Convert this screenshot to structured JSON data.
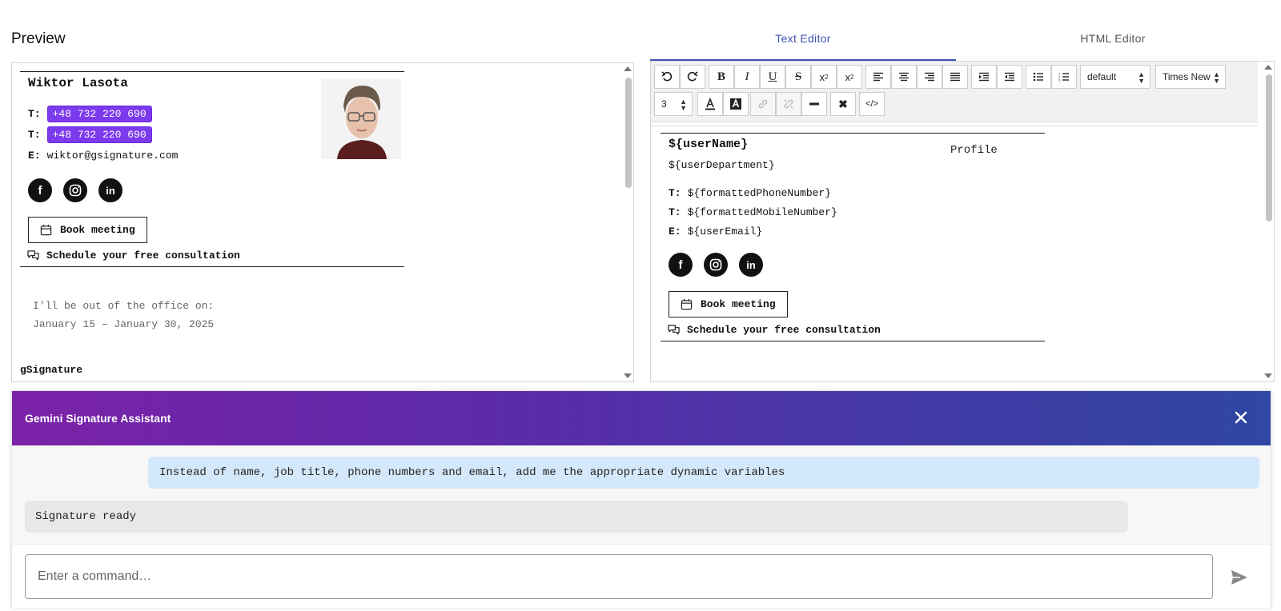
{
  "preview": {
    "title": "Preview",
    "signature": {
      "name": "Wiktor Lasota",
      "phone_label": "T:",
      "phone": "+48 732 220 690",
      "mobile_label": "T:",
      "mobile": "+48 732 220 690",
      "email_label": "E:",
      "email": "wiktor@gsignature.com",
      "socials": [
        "facebook-icon",
        "instagram-icon",
        "linkedin-icon"
      ],
      "book_label": "Book meeting",
      "consult_label": "Schedule your free consultation",
      "accent": "#7c3aed"
    },
    "ooo_line1": "I'll be out of the office on:",
    "ooo_line2": "January 15 – January 30, 2025",
    "brand": "gSignature"
  },
  "tabs": [
    {
      "label": "Text Editor",
      "active": true
    },
    {
      "label": "HTML Editor",
      "active": false
    }
  ],
  "toolbar": {
    "format_select": "default",
    "font_select": "Times New R",
    "size_select": "3"
  },
  "editor": {
    "name": "${userName}",
    "department": "${userDepartment}",
    "profile_alt": "Profile",
    "phone_label": "T:",
    "phone": "${formattedPhoneNumber}",
    "mobile_label": "T:",
    "mobile": "${formattedMobileNumber}",
    "email_label": "E:",
    "email": "${userEmail}",
    "book_label": "Book meeting",
    "consult_label": "Schedule your free consultation"
  },
  "assistant": {
    "title": "Gemini Signature Assistant",
    "user_message": "Instead of name, job title, phone numbers and email, add me the appropriate dynamic variables",
    "bot_message": "Signature ready",
    "input_placeholder": "Enter a command…",
    "header_gradient": [
      "#7b22a8",
      "#2f47a3"
    ]
  }
}
